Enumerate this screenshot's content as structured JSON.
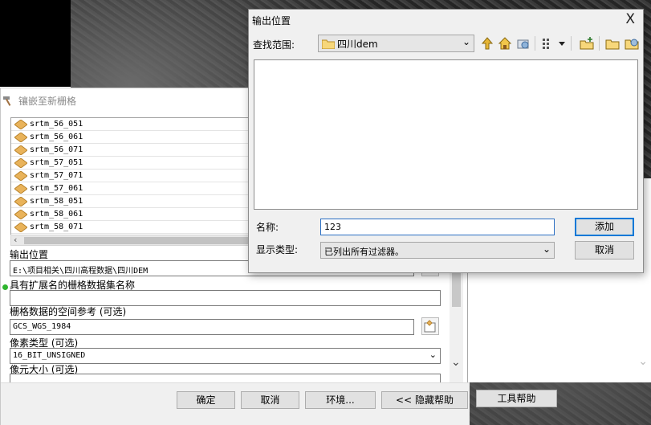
{
  "tool_dialog": {
    "title": "镶嵌至新栅格",
    "rasters": [
      "srtm_56_051",
      "srtm_56_061",
      "srtm_56_071",
      "srtm_57_051",
      "srtm_57_071",
      "srtm_57_061",
      "srtm_58_051",
      "srtm_58_061",
      "srtm_58_071"
    ],
    "output_location_label": "输出位置",
    "output_location_value": "E:\\项目相关\\四川高程数据\\四川DEM",
    "dataset_name_label": "具有扩展名的栅格数据集名称",
    "dataset_name_value": "",
    "spatial_ref_label": "栅格数据的空间参考 (可选)",
    "spatial_ref_value": "GCS_WGS_1984",
    "pixel_type_label": "像素类型 (可选)",
    "pixel_type_value": "16_BIT_UNSIGNED",
    "cell_size_label": "像元大小 (可选)",
    "buttons": {
      "ok": "确定",
      "cancel": "取消",
      "env": "环境...",
      "hide_help": "<< 隐藏帮助",
      "tool_help": "工具帮助"
    }
  },
  "output_dialog": {
    "title": "输出位置",
    "close": "X",
    "look_in_label": "查找范围:",
    "look_in_value": "四川dem",
    "name_label": "名称:",
    "name_value": "123",
    "type_label": "显示类型:",
    "type_value": "已列出所有过滤器。",
    "add_button": "添加",
    "cancel_button": "取消"
  },
  "colors": {
    "accent": "#0078d7",
    "folder": "#e8c25a",
    "raster": "#e9b35a"
  }
}
